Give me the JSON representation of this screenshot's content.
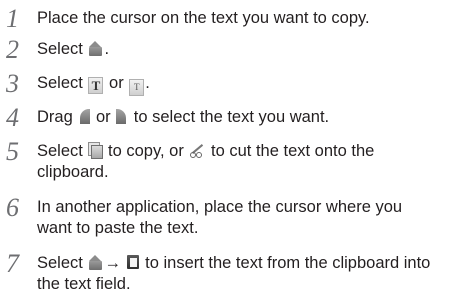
{
  "steps": [
    {
      "number": "1",
      "text": "Place the cursor on the text you want to copy."
    },
    {
      "number": "2",
      "before": "Select ",
      "after": "."
    },
    {
      "number": "3",
      "before": "Select ",
      "mid": " or ",
      "after": "."
    },
    {
      "number": "4",
      "before": "Drag ",
      "mid": " or ",
      "after": " to select the text you want."
    },
    {
      "number": "5",
      "before": "Select ",
      "mid": " to copy, or ",
      "after": " to cut the text onto the",
      "line2": "clipboard."
    },
    {
      "number": "6",
      "line1": "In another application, place the cursor where you",
      "line2": "want to paste the text."
    },
    {
      "number": "7",
      "before": "Select ",
      "arrow": "→",
      "after": " to insert the text from the clipboard into",
      "line2": "the text field."
    }
  ],
  "icons": {
    "home": "home-icon",
    "text_select": "text-select-icon",
    "text_select_all": "text-select-all-icon",
    "handle_left": "selection-handle-left-icon",
    "handle_right": "selection-handle-right-icon",
    "copy": "copy-icon",
    "cut": "cut-icon",
    "paste": "paste-icon"
  },
  "icon_glyphs": {
    "text_select": "T",
    "text_select_all": "T"
  },
  "colors": {
    "text": "#231f20",
    "step_number": "#6d6e71",
    "icon_gray": "#8c8c8c"
  }
}
